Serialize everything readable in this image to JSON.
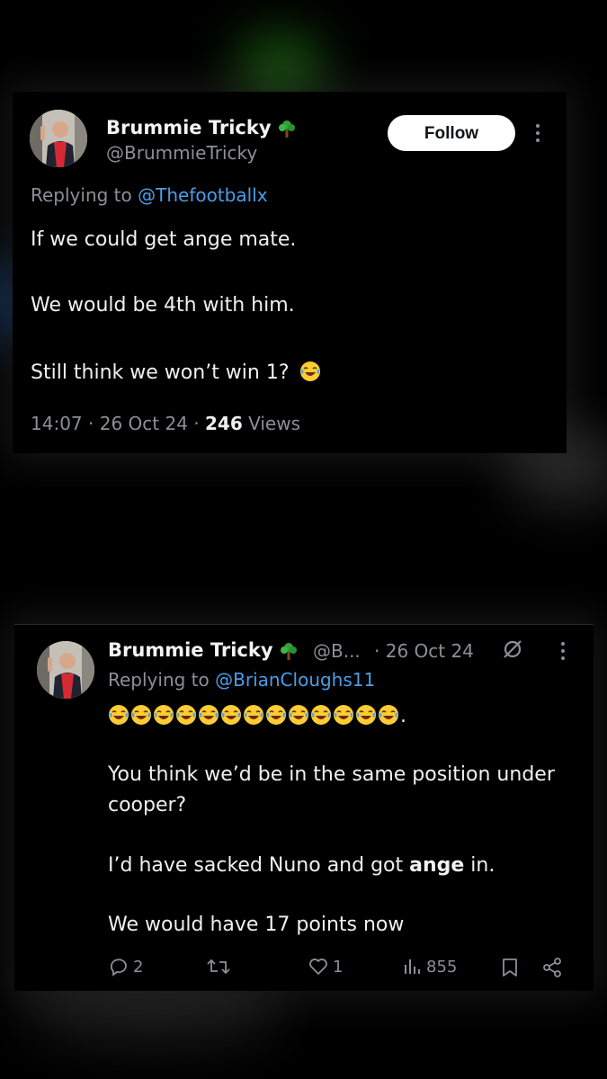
{
  "tweet1": {
    "name": "Brummie Tricky",
    "handle": "@BrummieTricky",
    "follow_label": "Follow",
    "replying_prefix": "Replying to ",
    "replying_mention": "@Thefootballx",
    "lines": [
      "If we could get ange mate.",
      "We would be 4th with him.",
      "Still think we won’t win 1?"
    ],
    "time": "14:07",
    "date": "26 Oct 24",
    "views_count": "246",
    "views_label": "Views"
  },
  "tweet2": {
    "name": "Brummie Tricky",
    "handle_truncated": "@B...",
    "date": "· 26 Oct 24",
    "replying_prefix": "Replying to ",
    "replying_mention": "@BrianCloughs11",
    "emoji_count": 13,
    "emoji_trail": ".",
    "line1a": "You think we’d be in the same position under",
    "line1b": "cooper?",
    "line2_pre": "I’d have sacked Nuno and got ",
    "line2_bold": "ange",
    "line2_post": " in.",
    "line3": "We would have 17 points now",
    "actions": {
      "replies": "2",
      "likes": "1",
      "views": "855"
    }
  },
  "icons": {
    "verified_badge": "tree-icon",
    "emoji": "laughing-tears-emoji",
    "reply": "reply-icon",
    "retweet": "retweet-icon",
    "like": "heart-icon",
    "views": "views-icon",
    "bookmark": "bookmark-icon",
    "share": "share-icon",
    "grok": "grok-icon"
  },
  "colors": {
    "background": "#000000",
    "text": "#f0f0f0",
    "muted": "#8b9096",
    "link": "#4a9ee8",
    "follow_bg": "#ffffff"
  }
}
